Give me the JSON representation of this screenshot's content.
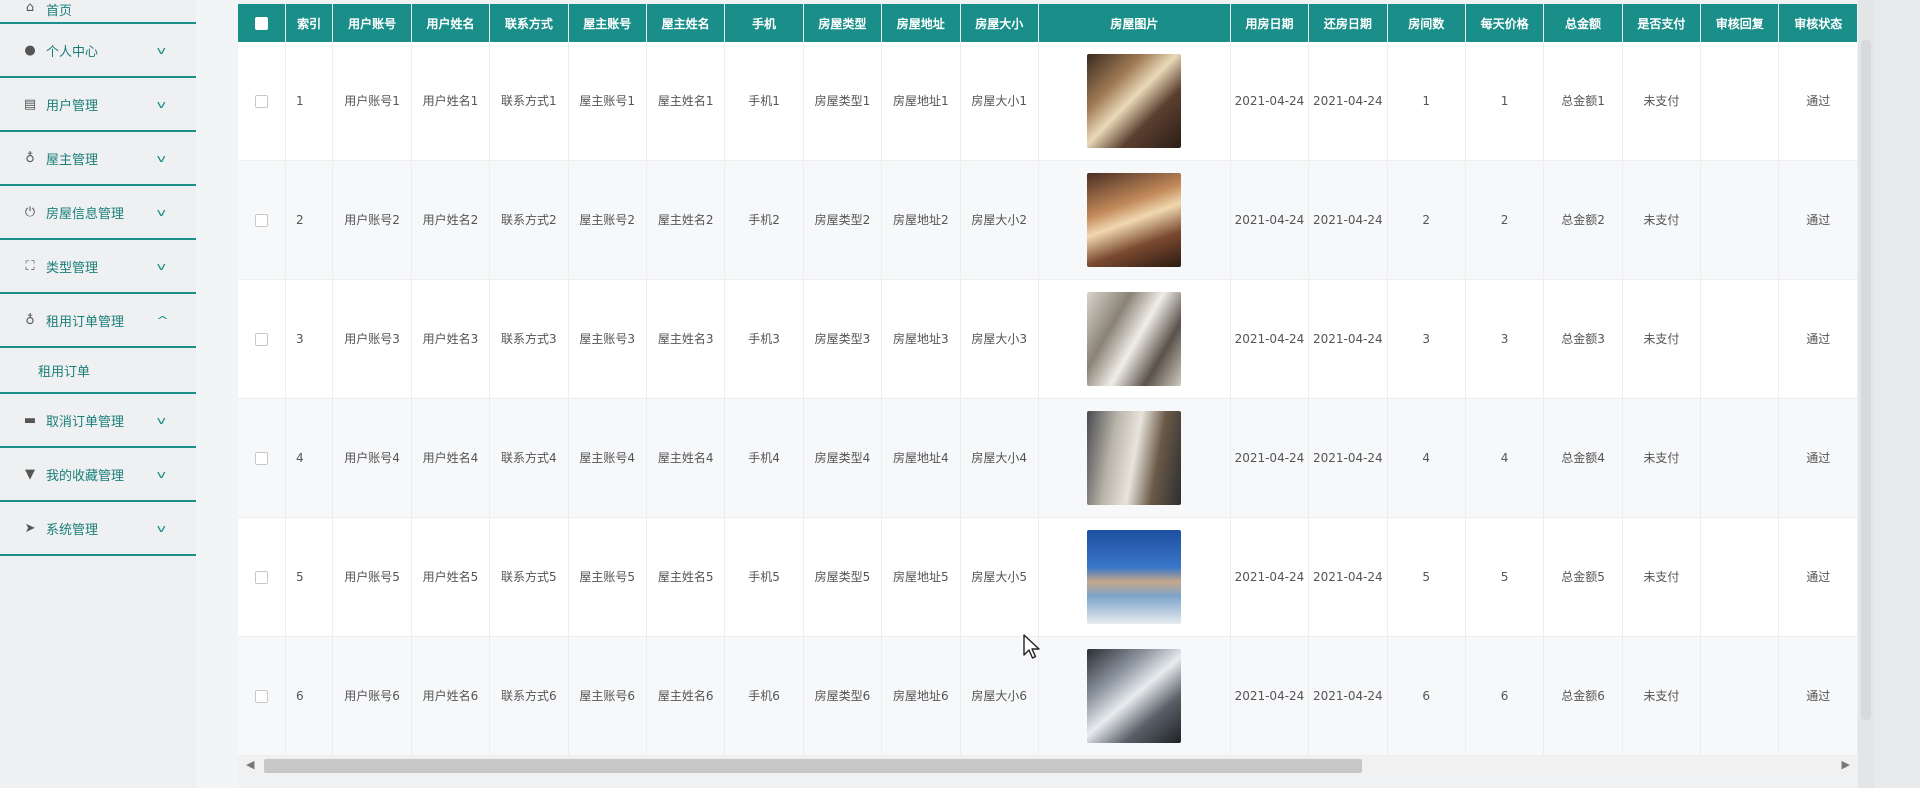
{
  "sidebar": {
    "items": [
      {
        "label": "首页",
        "icon": "home-icon",
        "chevron": false
      },
      {
        "label": "个人中心",
        "icon": "user-icon",
        "chevron": true
      },
      {
        "label": "用户管理",
        "icon": "chart-icon",
        "chevron": true
      },
      {
        "label": "屋主管理",
        "icon": "mic-icon",
        "chevron": true
      },
      {
        "label": "房屋信息管理",
        "icon": "power-icon",
        "chevron": true
      },
      {
        "label": "类型管理",
        "icon": "expand-icon",
        "chevron": true
      },
      {
        "label": "租用订单管理",
        "icon": "mic-icon",
        "chevron": true,
        "expanded": true,
        "sub": [
          "租用订单"
        ]
      },
      {
        "label": "取消订单管理",
        "icon": "briefcase-icon",
        "chevron": true
      },
      {
        "label": "我的收藏管理",
        "icon": "pin-icon",
        "chevron": true
      },
      {
        "label": "系统管理",
        "icon": "send-icon",
        "chevron": true
      }
    ]
  },
  "table": {
    "headers": [
      "索引",
      "用户账号",
      "用户姓名",
      "联系方式",
      "屋主账号",
      "屋主姓名",
      "手机",
      "房屋类型",
      "房屋地址",
      "房屋大小",
      "房屋图片",
      "用房日期",
      "还房日期",
      "房间数",
      "每天价格",
      "总金额",
      "是否支付",
      "审核回复",
      "审核状态"
    ],
    "rows": [
      {
        "c": [
          "1",
          "用户账号1",
          "用户姓名1",
          "联系方式1",
          "屋主账号1",
          "屋主姓名1",
          "手机1",
          "房屋类型1",
          "房屋地址1",
          "房屋大小1",
          "",
          "2021-04-24",
          "2021-04-24",
          "1",
          "1",
          "总金额1",
          "未支付",
          "",
          "通过"
        ],
        "img": "t1"
      },
      {
        "c": [
          "2",
          "用户账号2",
          "用户姓名2",
          "联系方式2",
          "屋主账号2",
          "屋主姓名2",
          "手机2",
          "房屋类型2",
          "房屋地址2",
          "房屋大小2",
          "",
          "2021-04-24",
          "2021-04-24",
          "2",
          "2",
          "总金额2",
          "未支付",
          "",
          "通过"
        ],
        "img": "t2"
      },
      {
        "c": [
          "3",
          "用户账号3",
          "用户姓名3",
          "联系方式3",
          "屋主账号3",
          "屋主姓名3",
          "手机3",
          "房屋类型3",
          "房屋地址3",
          "房屋大小3",
          "",
          "2021-04-24",
          "2021-04-24",
          "3",
          "3",
          "总金额3",
          "未支付",
          "",
          "通过"
        ],
        "img": "t3"
      },
      {
        "c": [
          "4",
          "用户账号4",
          "用户姓名4",
          "联系方式4",
          "屋主账号4",
          "屋主姓名4",
          "手机4",
          "房屋类型4",
          "房屋地址4",
          "房屋大小4",
          "",
          "2021-04-24",
          "2021-04-24",
          "4",
          "4",
          "总金额4",
          "未支付",
          "",
          "通过"
        ],
        "img": "t4"
      },
      {
        "c": [
          "5",
          "用户账号5",
          "用户姓名5",
          "联系方式5",
          "屋主账号5",
          "屋主姓名5",
          "手机5",
          "房屋类型5",
          "房屋地址5",
          "房屋大小5",
          "",
          "2021-04-24",
          "2021-04-24",
          "5",
          "5",
          "总金额5",
          "未支付",
          "",
          "通过"
        ],
        "img": "t5"
      },
      {
        "c": [
          "6",
          "用户账号6",
          "用户姓名6",
          "联系方式6",
          "屋主账号6",
          "屋主姓名6",
          "手机6",
          "房屋类型6",
          "房屋地址6",
          "房屋大小6",
          "",
          "2021-04-24",
          "2021-04-24",
          "6",
          "6",
          "总金额6",
          "未支付",
          "",
          "通过"
        ],
        "img": "t6"
      }
    ]
  },
  "scrollbar": {
    "horizontal_position": 0,
    "horizontal_visible_fraction": 0.7,
    "left_arrow": "◀",
    "right_arrow": "▶"
  }
}
